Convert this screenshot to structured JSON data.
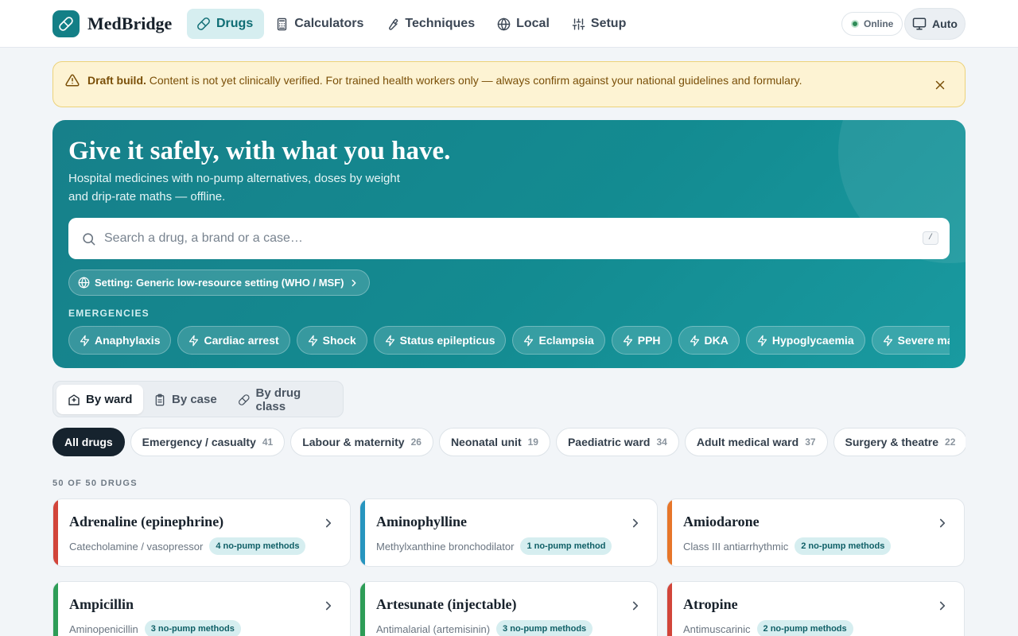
{
  "header": {
    "brand": "MedBridge",
    "nav": [
      {
        "label": "Drugs",
        "icon": "pill-icon",
        "active": true
      },
      {
        "label": "Calculators",
        "icon": "calculator-icon"
      },
      {
        "label": "Techniques",
        "icon": "wrench-icon"
      },
      {
        "label": "Local",
        "icon": "globe-icon"
      },
      {
        "label": "Setup",
        "icon": "sliders-icon"
      }
    ],
    "status": "Online",
    "theme_label": "Auto"
  },
  "banner": {
    "strong": "Draft build.",
    "text": " Content is not yet clinically verified. For trained health workers only — always confirm against your national guidelines and formulary."
  },
  "hero": {
    "title": "Give it safely, with what you have.",
    "subtitle": "Hospital medicines with no-pump alternatives, doses by weight and drip-rate maths — offline.",
    "search_placeholder": "Search a drug, a brand or a case…",
    "search_shortcut": "/",
    "setting_label": "Setting: Generic low-resource setting (WHO / MSF)",
    "emergencies_label": "EMERGENCIES",
    "emergencies": [
      "Anaphylaxis",
      "Cardiac arrest",
      "Shock",
      "Status epilepticus",
      "Eclampsia",
      "PPH",
      "DKA",
      "Hypoglycaemia",
      "Severe malaria"
    ]
  },
  "view_tabs": [
    {
      "label": "By ward",
      "icon": "hospital-icon",
      "active": true
    },
    {
      "label": "By case",
      "icon": "clipboard-icon"
    },
    {
      "label": "By drug class",
      "icon": "pill-icon"
    }
  ],
  "wards": [
    {
      "label": "All drugs",
      "count": "",
      "active": true
    },
    {
      "label": "Emergency / casualty",
      "count": "41"
    },
    {
      "label": "Labour & maternity",
      "count": "26"
    },
    {
      "label": "Neonatal unit",
      "count": "19"
    },
    {
      "label": "Paediatric ward",
      "count": "34"
    },
    {
      "label": "Adult medical ward",
      "count": "37"
    },
    {
      "label": "Surgery & theatre",
      "count": "22"
    },
    {
      "label": "",
      "count": ""
    }
  ],
  "count_label": "50 OF 50 DRUGS",
  "drugs": [
    {
      "name": "Adrenaline (epinephrine)",
      "class": "Catecholamine / vasopressor",
      "badge": "4 no-pump methods",
      "color": "#d2453a"
    },
    {
      "name": "Aminophylline",
      "class": "Methylxanthine bronchodilator",
      "badge": "1 no-pump method",
      "color": "#2795bf"
    },
    {
      "name": "Amiodarone",
      "class": "Class III antiarrhythmic",
      "badge": "2 no-pump methods",
      "color": "#e7762a"
    },
    {
      "name": "Ampicillin",
      "class": "Aminopenicillin",
      "badge": "3 no-pump methods",
      "color": "#2e9d57"
    },
    {
      "name": "Artesunate (injectable)",
      "class": "Antimalarial (artemisinin)",
      "badge": "3 no-pump methods",
      "color": "#2e9d57"
    },
    {
      "name": "Atropine",
      "class": "Antimuscarinic",
      "badge": "2 no-pump methods",
      "color": "#d2453a"
    }
  ]
}
